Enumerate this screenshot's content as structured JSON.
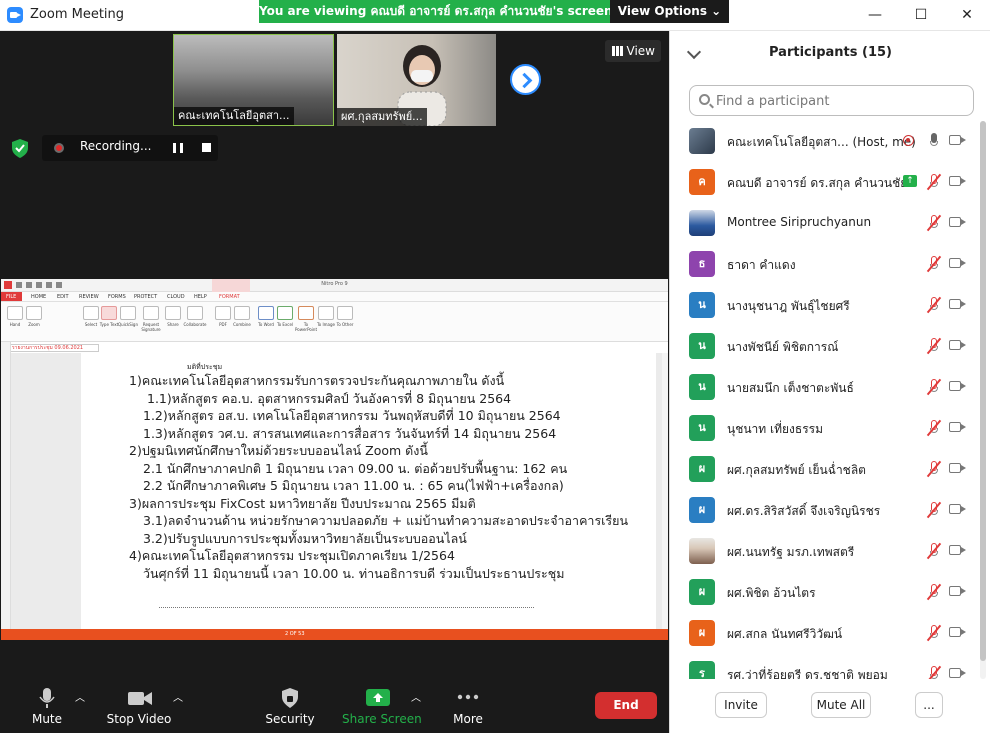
{
  "window": {
    "title": "Zoom Meeting",
    "min": "—",
    "max": "☐",
    "close": "✕"
  },
  "banner": {
    "viewing": "You are viewing คณบดี อาจารย์ ดร.สกุล คำนวนชัย's screen",
    "view_options": "View Options ⌄"
  },
  "gallery": {
    "thumbs": [
      {
        "label": "คณะเทคโนโลยีอุตสา..."
      },
      {
        "label": "ผศ.กุลสมทรัพย์..."
      }
    ],
    "view_label": "View"
  },
  "recording": {
    "label": "Recording..."
  },
  "shared_screen": {
    "app_title": "Nitro Pro 9",
    "tabs": [
      "FILE",
      "HOME",
      "EDIT",
      "REVIEW",
      "FORMS",
      "PROTECT",
      "CLOUD",
      "HELP",
      "FORMAT"
    ],
    "tools": [
      "Hand",
      "Zoom",
      "Select",
      "Type Text",
      "QuickSign",
      "Request Signature",
      "Share",
      "Collaborate",
      "PDF",
      "Combine",
      "To Word",
      "To Excel",
      "To PowerPoint",
      "To Image",
      "To Other"
    ],
    "doc_tab": "รายงานการประชุม 09.06.2021",
    "doc_lines": [
      "มติที่ประชุม",
      "1)คณะเทคโนโลยีอุตสาหกรรมรับการตรวจประกันคุณภาพภายใน ดังนี้",
      "1.1)หลักสูตร คอ.บ. อุตสาหกรรมศิลป์ วันอังคารที่ 8 มิถุนายน 2564",
      "1.2)หลักสูตร อส.บ. เทคโนโลยีอุตสาหกรรม วันพฤหัสบดีที่ 10 มิถุนายน 2564",
      "1.3)หลักสูตร วศ.บ. สารสนเทศและการสื่อสาร วันจันทร์ที่ 14 มิถุนายน 2564",
      "2)ปฐมนิเทศนักศึกษาใหม่ด้วยระบบออนไลน์ Zoom ดังนี้",
      "2.1 นักศึกษาภาคปกติ 1 มิถุนายน เวลา 09.00 น. ต่อด้วยปรับพื้นฐาน: 162 คน",
      "2.2 นักศึกษาภาคพิเศษ 5 มิถุนายน เวลา 11.00 น. : 65 คน(ไฟฟ้า+เครื่องกล)",
      "3)ผลการประชุม FixCost มหาวิทยาลัย ปีงบประมาณ 2565 มีมติ",
      "3.1)ลดจำนวนด้าน หน่วยรักษาความปลอดภัย + แม่บ้านทำความสะอาดประจำอาคารเรียน",
      "3.2)ปรับรูปแบบการประชุมทั้งมหาวิทยาลัยเป็นระบบออนไลน์",
      "4)คณะเทคโนโลยีอุตสาหกรรม ประชุมเปิดภาคเรียน 1/2564",
      "วันศุกร์ที่ 11 มิถุนายนนี้ เวลา 10.00 น. ท่านอธิการบดี ร่วมเป็นประธานประชุม"
    ],
    "status_page": "2 OF 53"
  },
  "controls": {
    "mute": "Mute",
    "stop_video": "Stop Video",
    "security": "Security",
    "share_screen": "Share Screen",
    "more": "More",
    "end": "End"
  },
  "panel": {
    "title": "Participants (15)",
    "search_placeholder": "Find a participant",
    "participants": [
      {
        "name": "คณะเทคโนโลยีอุตสา...  (Host, me)",
        "avatar": "",
        "avatar_color": "photo",
        "mic": "live",
        "recording": true
      },
      {
        "name": "คณบดี อาจารย์ ดร.สกุล คำนวนชัย",
        "avatar": "ค",
        "avatar_color": "#e8621a",
        "mic": "muted",
        "sharing": true
      },
      {
        "name": "Montree Siripruchyanun",
        "avatar": "",
        "avatar_color": "photo2",
        "mic": "muted"
      },
      {
        "name": "ธาดา คำแดง",
        "avatar": "ธ",
        "avatar_color": "#8e44ad",
        "mic": "muted"
      },
      {
        "name": "นางนุชนาฎ   พันธุ์ไชยศรี",
        "avatar": "น",
        "avatar_color": "#2a7ec2",
        "mic": "muted"
      },
      {
        "name": "นางพัชนีย์   พิชิตการณ์",
        "avatar": "น",
        "avatar_color": "#22a05a",
        "mic": "muted"
      },
      {
        "name": "นายสมนึก  เต็งชาตะพันธ์",
        "avatar": "น",
        "avatar_color": "#22a05a",
        "mic": "muted"
      },
      {
        "name": "นุชนาท   เที่ยงธรรม",
        "avatar": "น",
        "avatar_color": "#22a05a",
        "mic": "muted"
      },
      {
        "name": "ผศ.กุลสมทรัพย์  เย็นฉ่ำชลิต",
        "avatar": "ผ",
        "avatar_color": "#22a05a",
        "mic": "muted"
      },
      {
        "name": "ผศ.ดร.สิริสวัสดิ์  จึงเจริญนิรชร",
        "avatar": "ผ",
        "avatar_color": "#2a7ec2",
        "mic": "muted"
      },
      {
        "name": "ผศ.นนทรัฐ มรภ.เทพสตรี",
        "avatar": "",
        "avatar_color": "photo3",
        "mic": "muted"
      },
      {
        "name": "ผศ.พิชิต   อ้วนไตร",
        "avatar": "ผ",
        "avatar_color": "#22a05a",
        "mic": "muted"
      },
      {
        "name": "ผศ.สกล  นันทศรีวิวัฒน์",
        "avatar": "ผ",
        "avatar_color": "#e8621a",
        "mic": "muted"
      },
      {
        "name": "รศ.ว่าที่ร้อยตรี ดร.ชชาติ  พยอม",
        "avatar": "ร",
        "avatar_color": "#22a05a",
        "mic": "muted"
      }
    ],
    "invite": "Invite",
    "mute_all": "Mute All",
    "more": "..."
  }
}
